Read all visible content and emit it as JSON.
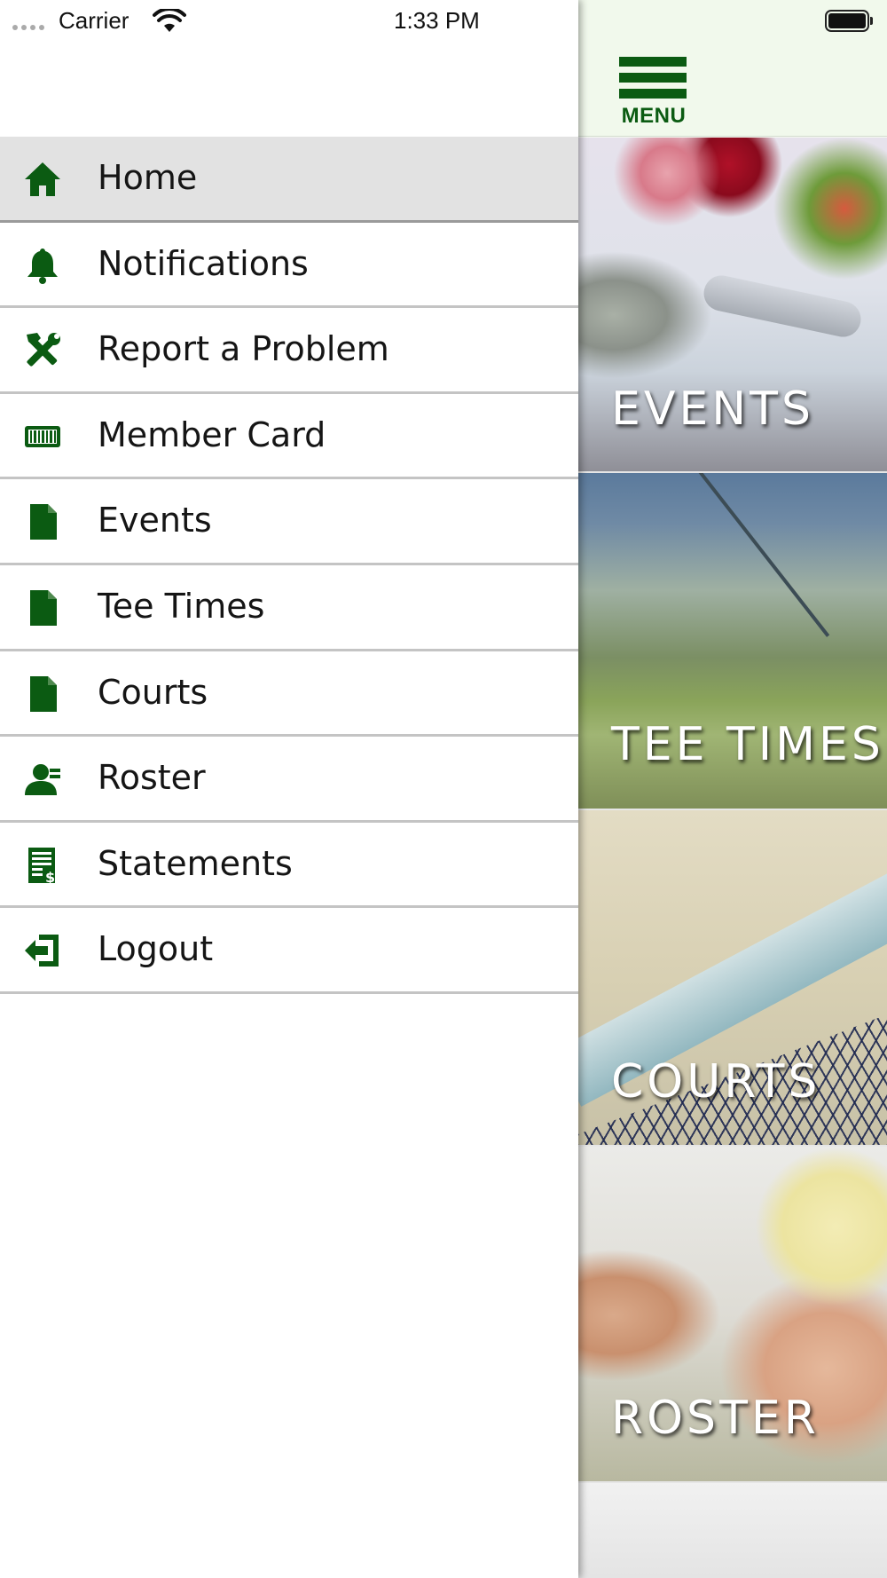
{
  "status_bar": {
    "carrier": "Carrier",
    "time": "1:33 PM"
  },
  "header": {
    "menu_label": "MENU"
  },
  "drawer": {
    "items": [
      {
        "label": "Home",
        "icon": "home-icon",
        "active": true
      },
      {
        "label": "Notifications",
        "icon": "bell-icon"
      },
      {
        "label": "Report a Problem",
        "icon": "tools-icon"
      },
      {
        "label": "Member Card",
        "icon": "barcode-icon"
      },
      {
        "label": "Events",
        "icon": "document-icon"
      },
      {
        "label": "Tee Times",
        "icon": "document-icon"
      },
      {
        "label": "Courts",
        "icon": "document-icon"
      },
      {
        "label": "Roster",
        "icon": "user-icon"
      },
      {
        "label": "Statements",
        "icon": "statement-icon"
      },
      {
        "label": "Logout",
        "icon": "logout-icon"
      }
    ]
  },
  "tiles": [
    {
      "label": "EVENTS"
    },
    {
      "label": "TEE TIMES"
    },
    {
      "label": "COURTS"
    },
    {
      "label": "ROSTER"
    }
  ],
  "colors": {
    "brand_green": "#0b5b12",
    "header_bg": "#f1f9ec",
    "active_row": "#e2e2e2"
  }
}
